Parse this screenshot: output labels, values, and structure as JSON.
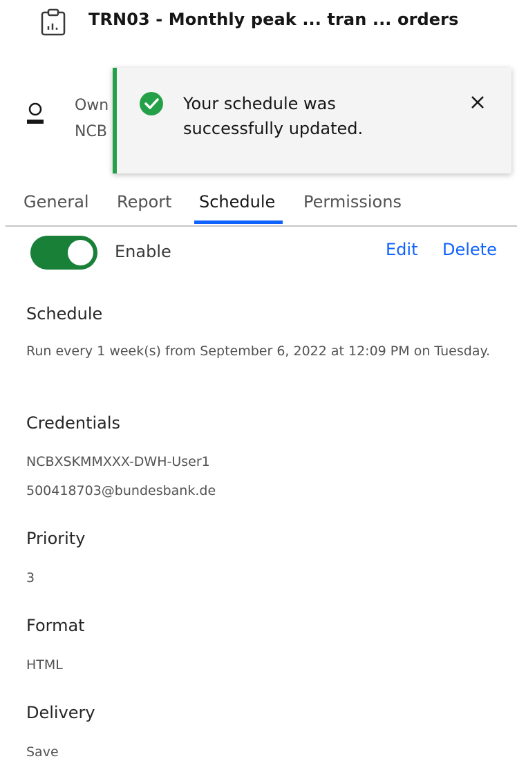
{
  "header": {
    "title": "TRN03 - Monthly peak ... tran ... orders",
    "icon": "report-icon"
  },
  "owner": {
    "icon": "user-icon",
    "label": "Own",
    "value": "NCB"
  },
  "toast": {
    "icon": "checkmark-filled-icon",
    "message": "Your schedule was successfully updated.",
    "close_icon": "close-icon",
    "accent_color": "#24a148"
  },
  "tabs": [
    {
      "label": "General"
    },
    {
      "label": "Report"
    },
    {
      "label": "Schedule",
      "active": true
    },
    {
      "label": "Permissions"
    }
  ],
  "schedule_panel": {
    "toggle_state": "on",
    "enable_label": "Enable",
    "edit_label": "Edit",
    "delete_label": "Delete",
    "sections": {
      "schedule": {
        "title": "Schedule",
        "text": "Run every 1 week(s) from September 6, 2022 at 12:09 PM on Tuesday."
      },
      "credentials": {
        "title": "Credentials",
        "line1": "NCBXSKMMXXX-DWH-User1",
        "line2": "500418703@bundesbank.de"
      },
      "priority": {
        "title": "Priority",
        "value": "3"
      },
      "format": {
        "title": "Format",
        "value": "HTML"
      },
      "delivery": {
        "title": "Delivery",
        "value": "Save"
      }
    }
  },
  "colors": {
    "toggle_on": "#198038",
    "link": "#0f62fe",
    "tab_indicator": "#0f62fe"
  }
}
